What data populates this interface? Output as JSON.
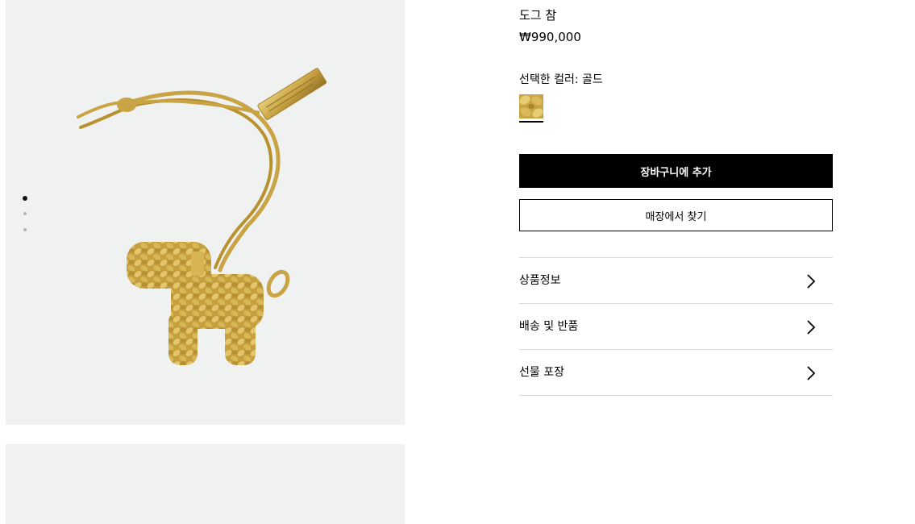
{
  "gallery": {
    "dots_count": 3,
    "active_index": 0
  },
  "product": {
    "title": "도그 참",
    "price": "₩990,000",
    "selected_color_label": "선택한 컬러: 골드",
    "swatch_color": "#c9a445"
  },
  "actions": {
    "add_to_cart": "장바구니에 추가",
    "find_in_store": "매장에서 찾기"
  },
  "accordion": [
    {
      "label": "상품정보",
      "icon": "chevron-right-icon"
    },
    {
      "label": "배송 및 반품",
      "icon": "chevron-right-icon"
    },
    {
      "label": "선물 포장",
      "icon": "chevron-right-icon"
    }
  ],
  "colors": {
    "image_bg": "#f0f1f1",
    "primary_button_bg": "#000000",
    "primary_button_text": "#ffffff",
    "divider": "#d9d9d9",
    "gold": "#c9a445"
  }
}
